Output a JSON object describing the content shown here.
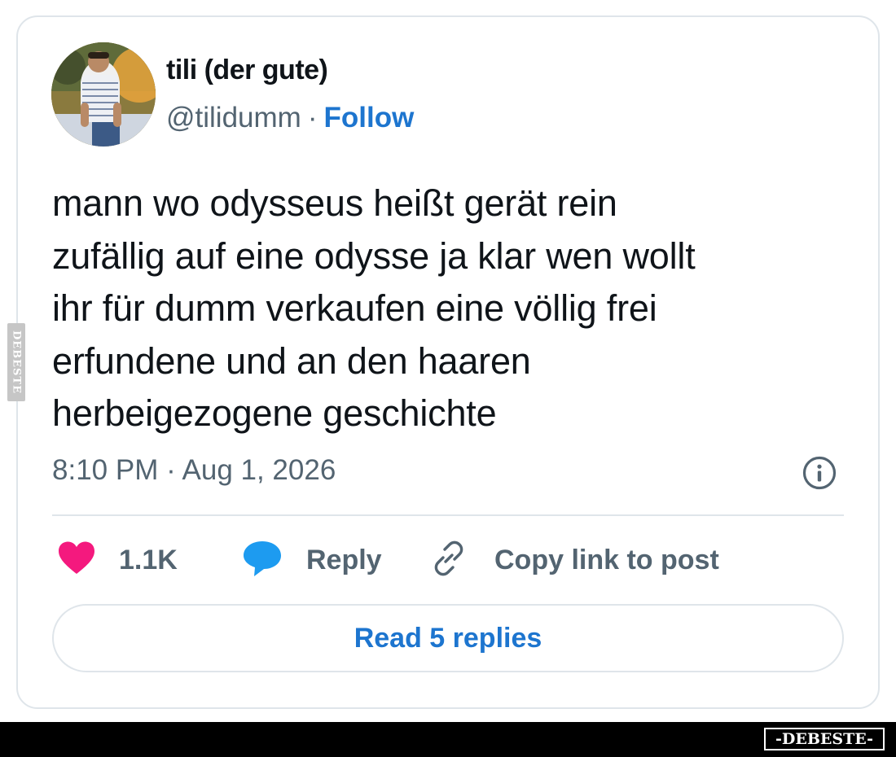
{
  "post": {
    "author": {
      "name": "tili (der gute)",
      "handle": "@tilidumm",
      "separator": "·",
      "follow_label": "Follow"
    },
    "text_lines": [
      "mann wo odysseus heißt gerät rein",
      "zufällig auf eine odysse ja klar wen wollt",
      "ihr für dumm verkaufen eine völlig frei",
      "erfundene und an den haaren",
      "herbeigezogene geschichte"
    ],
    "timestamp": "8:10 PM · Aug 1, 2026",
    "actions": {
      "like_count": "1.1K",
      "reply_label": "Reply",
      "copy_link_label": "Copy link to post"
    },
    "read_replies_label": "Read 5 replies",
    "icons": {
      "info": "info-icon",
      "like": "heart-icon",
      "reply": "speech-bubble-icon",
      "copy": "link-icon"
    }
  },
  "watermark": {
    "side_text": "DEBESTE",
    "brand_text": "-DEBESTE-"
  },
  "colors": {
    "link_blue": "#1d75cf",
    "heart_pink": "#f4197e",
    "reply_blue": "#1d9bf0",
    "text_dark": "#0f1419",
    "text_gray": "#536471",
    "border": "#dfe5ea"
  }
}
